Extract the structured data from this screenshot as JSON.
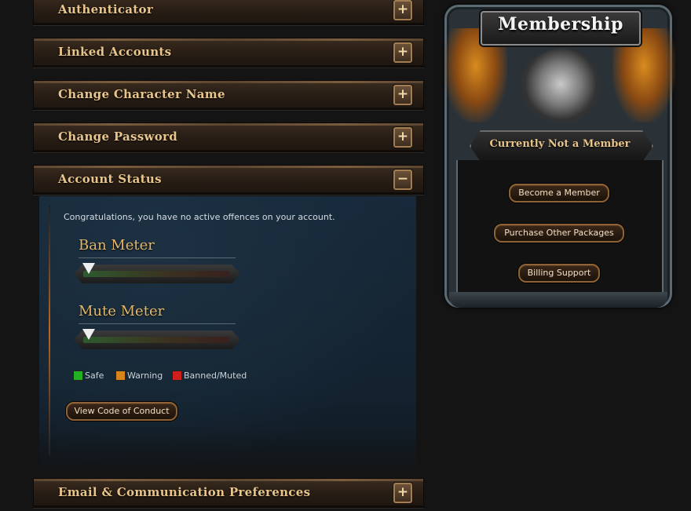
{
  "accordion": {
    "sections": [
      {
        "title": "Authenticator",
        "toggle": "+"
      },
      {
        "title": "Linked Accounts",
        "toggle": "+"
      },
      {
        "title": "Change Character Name",
        "toggle": "+"
      },
      {
        "title": "Change Password",
        "toggle": "+"
      },
      {
        "title": "Account Status",
        "toggle": "−"
      },
      {
        "title": "Email & Communication Preferences",
        "toggle": "+"
      }
    ]
  },
  "account_status": {
    "message": "Congratulations, you have no active offences on your account.",
    "ban_meter": {
      "label": "Ban Meter",
      "level": 0
    },
    "mute_meter": {
      "label": "Mute Meter",
      "level": 0
    },
    "legend": [
      {
        "label": "Safe",
        "color": "#22b022"
      },
      {
        "label": "Warning",
        "color": "#d8841c"
      },
      {
        "label": "Banned/Muted",
        "color": "#d01e1e"
      }
    ],
    "code_of_conduct_button": "View Code of Conduct"
  },
  "membership": {
    "title": "Membership",
    "status": "Currently Not a Member",
    "buttons": [
      "Become a Member",
      "Purchase Other Packages",
      "Billing Support"
    ]
  }
}
